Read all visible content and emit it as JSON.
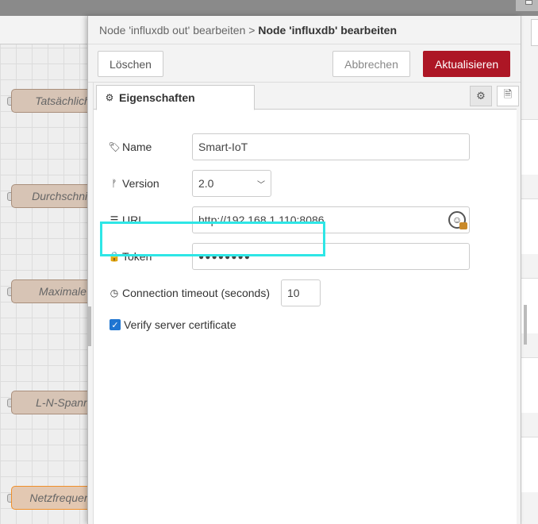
{
  "workspace": {
    "nodes": [
      {
        "label": "Tatsächlich"
      },
      {
        "label": "Durchschnitt"
      },
      {
        "label": "Maximale"
      },
      {
        "label": "L-N-Spann"
      },
      {
        "label": "Netzfrequenz"
      }
    ]
  },
  "tray": {
    "breadcrumb_parent": "Node 'influxdb out' bearbeiten",
    "breadcrumb_separator": ">",
    "breadcrumb_current": "Node 'influxdb' bearbeiten",
    "delete_label": "Löschen",
    "cancel_label": "Abbrechen",
    "update_label": "Aktualisieren",
    "tab_properties": "Eigenschaften"
  },
  "form": {
    "name_label": "Name",
    "name_value": "Smart-IoT",
    "version_label": "Version",
    "version_value": "2.0",
    "url_label": "URL",
    "url_value": "http://192.168.1.110:8086",
    "token_label": "Token",
    "token_value": "●●●●●●●●",
    "timeout_label": "Connection timeout (seconds)",
    "timeout_value": "10",
    "verify_label": "Verify server certificate",
    "verify_checked": true
  },
  "colors": {
    "update_button": "#ad1625",
    "highlight": "#2ee6e6",
    "checkbox": "#1f75d1"
  }
}
